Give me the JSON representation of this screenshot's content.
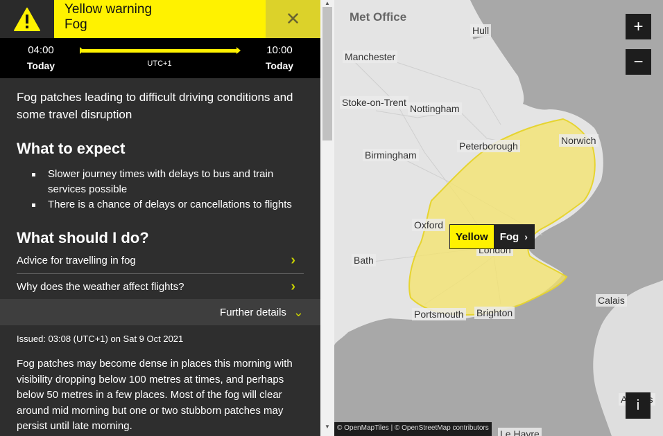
{
  "warning": {
    "level": "Yellow warning",
    "type": "Fog",
    "close_label": "✕"
  },
  "timeline": {
    "start_time": "04:00",
    "start_day": "Today",
    "end_time": "10:00",
    "end_day": "Today",
    "timezone": "UTC+1"
  },
  "summary": "Fog patches leading to difficult driving conditions and some travel disruption",
  "expect": {
    "title": "What to expect",
    "items": [
      "Slower journey times with delays to bus and train services possible",
      "There is a chance of delays or cancellations to flights"
    ]
  },
  "todo": {
    "title": "What should I do?",
    "links": [
      "Advice for travelling in fog",
      "Why does the weather affect flights?"
    ]
  },
  "further": "Further details",
  "issued": "Issued: 03:08 (UTC+1) on Sat 9 Oct 2021",
  "details": "Fog patches may become dense in places this morning with visibility dropping below 100 metres at times, and perhaps below 50 metres in a few places. Most of the fog will clear around mid morning but one or two stubborn patches may persist until late morning.",
  "map": {
    "logo": "Met Office",
    "zoom_in": "+",
    "zoom_out": "−",
    "info": "i",
    "attribution": "© OpenMapTiles | © OpenStreetMap contributors",
    "warning_label": {
      "level": "Yellow",
      "type": "Fog"
    },
    "cities": [
      "Hull",
      "Manchester",
      "Stoke-on-Trent",
      "Nottingham",
      "Peterborough",
      "Norwich",
      "Birmingham",
      "Oxford",
      "London",
      "Bath",
      "Calais",
      "Portsmouth",
      "Brighton",
      "Le Havre",
      "Amiens"
    ],
    "colors": {
      "warning_fill": "#f5e46a",
      "warning_stroke": "#e6d430",
      "land": "#e4e4e4",
      "sea": "#a8a8a8"
    }
  }
}
